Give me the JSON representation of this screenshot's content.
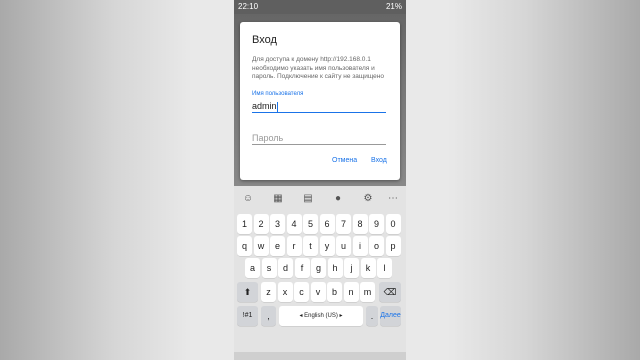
{
  "status_bar": {
    "time": "22:10",
    "battery": "21%"
  },
  "dialog": {
    "title": "Вход",
    "message": "Для доступа к домену http://192.168.0.1 необходимо указать имя пользователя и пароль. Подключение к сайту не защищено",
    "username_label": "Имя пользователя",
    "username_value": "admin",
    "password_placeholder": "Пароль",
    "cancel_label": "Отмена",
    "ok_label": "Вход"
  },
  "keyboard": {
    "toolbar_icons": [
      "emoji-icon",
      "sticker-icon",
      "clipboard-icon",
      "mic-icon",
      "settings-icon",
      "more-icon"
    ],
    "row_numbers": [
      "1",
      "2",
      "3",
      "4",
      "5",
      "6",
      "7",
      "8",
      "9",
      "0"
    ],
    "row_top": [
      "q",
      "w",
      "e",
      "r",
      "t",
      "y",
      "u",
      "i",
      "o",
      "p"
    ],
    "row_mid": [
      "a",
      "s",
      "d",
      "f",
      "g",
      "h",
      "j",
      "k",
      "l"
    ],
    "row_bottom": [
      "z",
      "x",
      "c",
      "v",
      "b",
      "n",
      "m"
    ],
    "symbols_label": "!#1",
    "comma_label": ",",
    "space_label": "English (US)",
    "period_label": ".",
    "done_label": "Далее"
  }
}
